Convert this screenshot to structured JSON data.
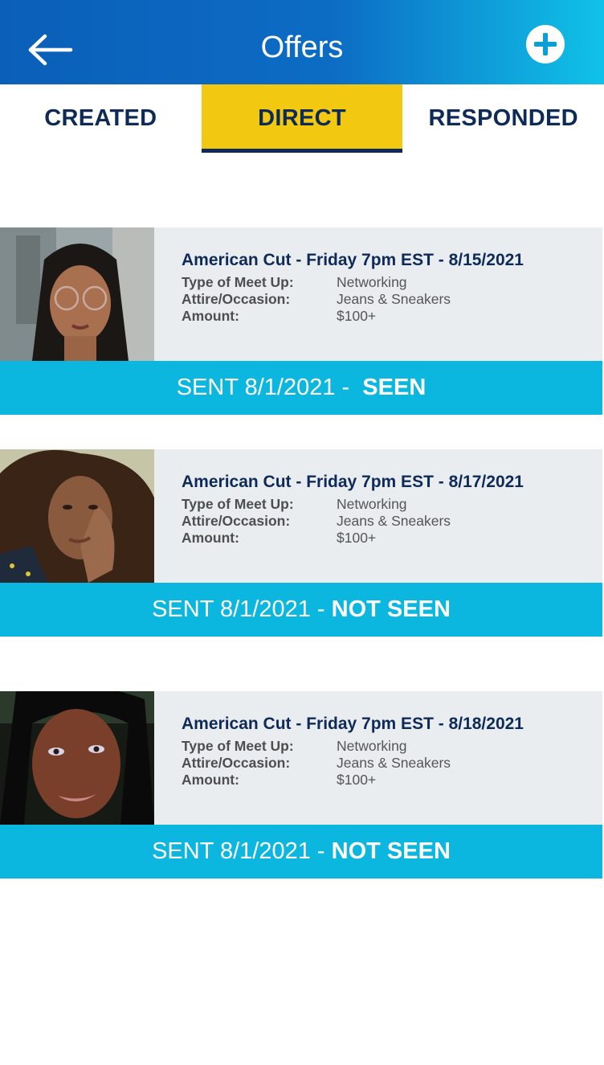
{
  "header": {
    "title": "Offers",
    "back_icon": "arrow-left-icon",
    "add_icon": "plus-circle-icon"
  },
  "tabs": [
    {
      "label": "CREATED",
      "active": false
    },
    {
      "label": "DIRECT",
      "active": true
    },
    {
      "label": "RESPONDED",
      "active": false
    }
  ],
  "offers": [
    {
      "title": "American Cut - Friday 7pm EST - 8/15/2021",
      "fields": [
        {
          "label": "Type of Meet Up:",
          "value": "Networking"
        },
        {
          "label": "Attire/Occasion:",
          "value": "Jeans & Sneakers"
        },
        {
          "label": "Amount:",
          "value": "$100+"
        }
      ],
      "status_prefix": "SENT 8/1/2021 -  ",
      "status": "SEEN"
    },
    {
      "title": "American Cut - Friday 7pm EST - 8/17/2021",
      "fields": [
        {
          "label": "Type of Meet Up:",
          "value": "Networking"
        },
        {
          "label": "Attire/Occasion:",
          "value": "Jeans & Sneakers"
        },
        {
          "label": "Amount:",
          "value": "$100+"
        }
      ],
      "status_prefix": "SENT 8/1/2021 - ",
      "status": "NOT SEEN"
    },
    {
      "title": "American Cut - Friday 7pm EST - 8/18/2021",
      "fields": [
        {
          "label": "Type of Meet Up:",
          "value": "Networking"
        },
        {
          "label": "Attire/Occasion:",
          "value": "Jeans & Sneakers"
        },
        {
          "label": "Amount:",
          "value": "$100+"
        }
      ],
      "status_prefix": "SENT 8/1/2021 - ",
      "status": "NOT SEEN"
    }
  ],
  "colors": {
    "header_start": "#0b5fb8",
    "header_end": "#10c2e8",
    "active_tab": "#f2c811",
    "navy": "#0e2a57",
    "status_bar": "#0bb7df",
    "card_bg": "#e9edf0"
  }
}
